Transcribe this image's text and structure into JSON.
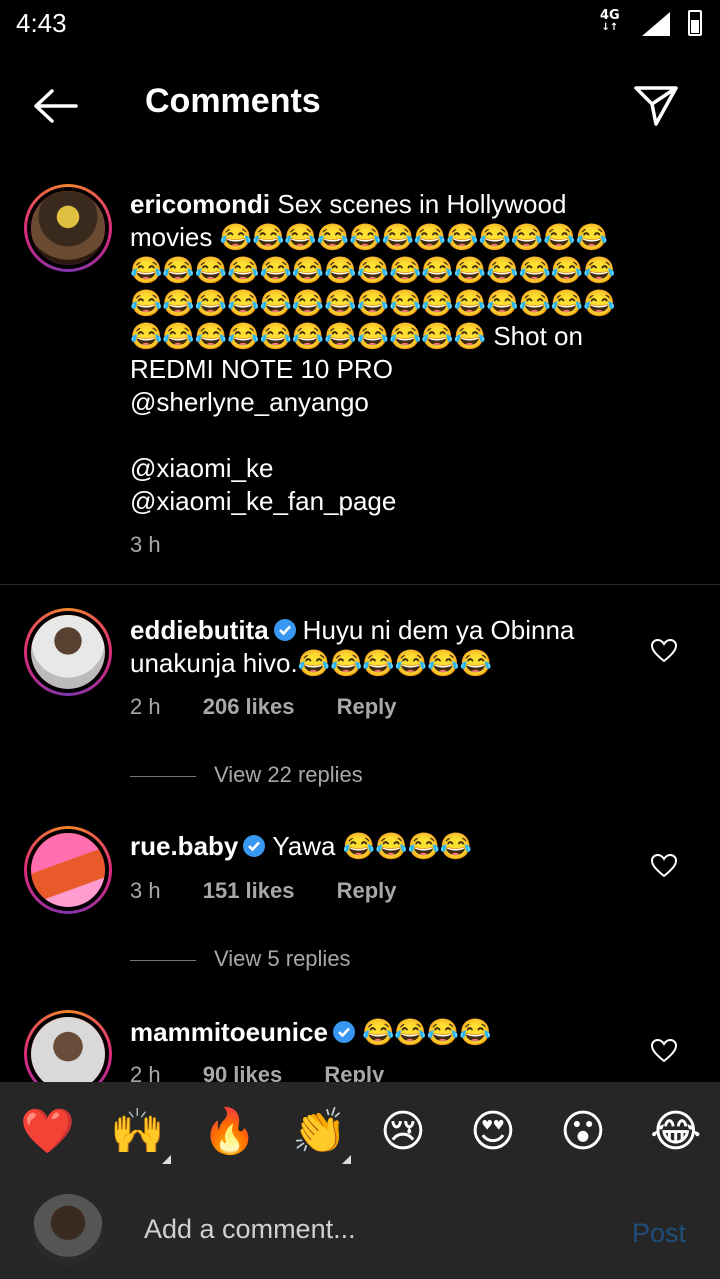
{
  "status": {
    "time": "4:43",
    "network": "4G"
  },
  "header": {
    "title": "Comments"
  },
  "post": {
    "username": "ericomondi",
    "text": "Sex scenes in Hollywood movies 😂😂😂😂😂😂😂😂😂😂😂😂😂😂😂😂😂😂😂😂😂😂😂😂😂😂😂😂😂😂😂😂😂😂😂😂😂😂😂😂😂😂😂😂😂😂😂😂😂😂😂😂😂 Shot on REDMI NOTE 10 PRO",
    "mention1": "@sherlyne_anyango",
    "mention2": "@xiaomi_ke",
    "mention3": "@xiaomi_ke_fan_page",
    "time": "3 h"
  },
  "comments": [
    {
      "username": "eddiebutita",
      "text": "Huyu ni dem ya Obinna unakunja hivo.😂😂😂😂😂😂",
      "time": "2 h",
      "likes": "206 likes",
      "reply": "Reply",
      "view_replies": "View 22 replies"
    },
    {
      "username": "rue.baby",
      "text": "Yawa 😂😂😂😂",
      "time": "3 h",
      "likes": "151 likes",
      "reply": "Reply",
      "view_replies": "View 5 replies"
    },
    {
      "username": "mammitoeunice",
      "text": "😂😂😂😂",
      "time": "2 h",
      "likes": "90 likes",
      "reply": "Reply"
    }
  ],
  "reactions": [
    "❤️",
    "🙌",
    "🔥",
    "👏",
    "😢",
    "😍",
    "😮",
    "😂"
  ],
  "composer": {
    "placeholder": "Add a comment...",
    "post_label": "Post"
  }
}
